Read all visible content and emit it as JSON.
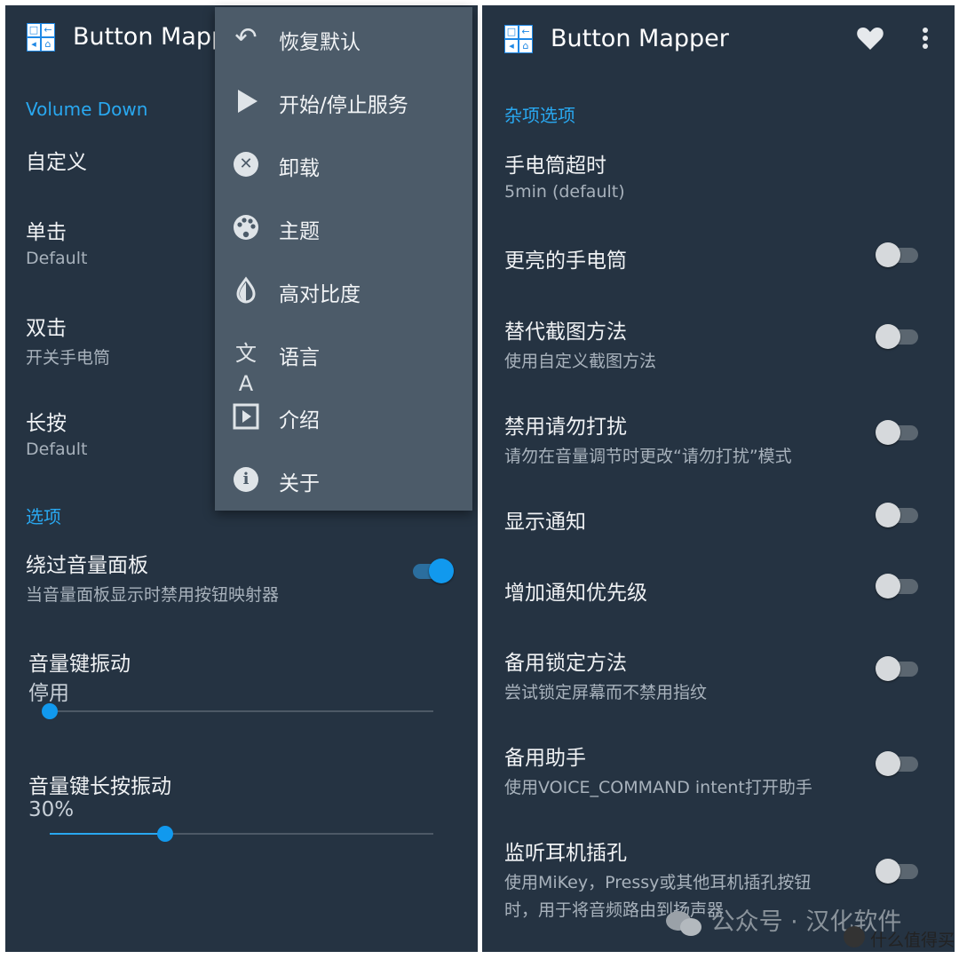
{
  "colors": {
    "background": "#253342",
    "menu_background": "#4c5b69",
    "accent": "#29a8f0",
    "text_primary": "#f0f2f4",
    "text_secondary": "#a8b2bc"
  },
  "left": {
    "app_title": "Button Mapper",
    "section_button": "Volume Down",
    "custom_label": "自定义",
    "prefs": [
      {
        "title": "单击",
        "summary": "Default"
      },
      {
        "title": "双击",
        "summary": "开关手电筒"
      },
      {
        "title": "长按",
        "summary": "Default"
      }
    ],
    "section_options": "选项",
    "bypass": {
      "title": "绕过音量面板",
      "summary": "当音量面板显示时禁用按钮映射器",
      "enabled": true
    },
    "vibration": {
      "title": "音量键振动",
      "value_text": "停用",
      "value_percent": 0
    },
    "long_vibration": {
      "title": "音量键长按振动",
      "value_text": "30%",
      "value_percent": 30
    }
  },
  "menu": {
    "items": [
      {
        "label": "恢复默认",
        "icon": "undo-icon"
      },
      {
        "label": "开始/停止服务",
        "icon": "play-icon"
      },
      {
        "label": "卸载",
        "icon": "uninstall-x-icon"
      },
      {
        "label": "主题",
        "icon": "palette-icon"
      },
      {
        "label": "高对比度",
        "icon": "contrast-icon"
      },
      {
        "label": "语言",
        "icon": "translate-icon"
      },
      {
        "label": "介绍",
        "icon": "slideshow-icon"
      },
      {
        "label": "关于",
        "icon": "info-icon"
      }
    ]
  },
  "right": {
    "app_title": "Button Mapper",
    "section_misc": "杂项选项",
    "flashlight_timeout": {
      "title": "手电筒超时",
      "summary": "5min (default)"
    },
    "toggles": [
      {
        "title": "更亮的手电筒",
        "summary": "",
        "enabled": false
      },
      {
        "title": "替代截图方法",
        "summary": "使用自定义截图方法",
        "enabled": false
      },
      {
        "title": "禁用请勿打扰",
        "summary": "请勿在音量调节时更改“请勿打扰”模式",
        "enabled": false
      },
      {
        "title": "显示通知",
        "summary": "",
        "enabled": false
      },
      {
        "title": "增加通知优先级",
        "summary": "",
        "enabled": false
      },
      {
        "title": "备用锁定方法",
        "summary": "尝试锁定屏幕而不禁用指纹",
        "enabled": false
      },
      {
        "title": "备用助手",
        "summary": "使用VOICE_COMMAND intent打开助手",
        "enabled": false
      }
    ],
    "headset": {
      "title": "监听耳机插孔",
      "summary_line1": "使用MiKey，Pressy或其他耳机插孔按钮",
      "summary_line2": "时，用于将音频路由到扬声器",
      "enabled": false
    }
  },
  "watermark": {
    "text": "公众号 · 汉化软件",
    "site": "什么值得买"
  }
}
